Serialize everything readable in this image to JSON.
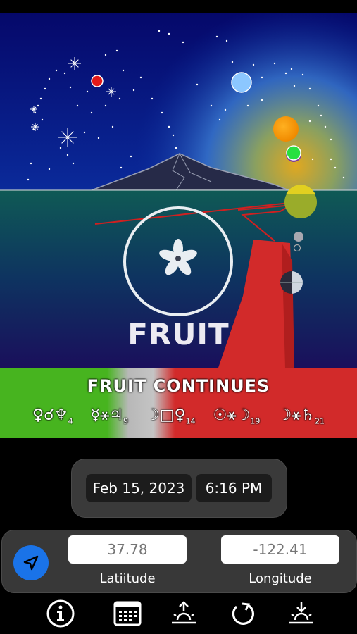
{
  "app": {
    "title": "FRUIT",
    "banner_title": "FRUIT CONTINUES",
    "aspects": [
      {
        "glyphs": "♀☌♆",
        "sub": "4"
      },
      {
        "glyphs": "☿⚹♃",
        "sub": "9"
      },
      {
        "glyphs": "☽□♀",
        "sub": "14"
      },
      {
        "glyphs": "☉⚹☽",
        "sub": "19"
      },
      {
        "glyphs": "☽⚹♄",
        "sub": "21"
      }
    ]
  },
  "datetime": {
    "date": "Feb 15, 2023",
    "time": "6:16 PM"
  },
  "location": {
    "latitude_placeholder": "37.78",
    "longitude_placeholder": "-122.41",
    "latitude_label": "Latiitude",
    "longitude_label": "Longitude"
  },
  "toolbar": {
    "items": [
      "info-icon",
      "calendar-icon",
      "sunrise-icon",
      "refresh-icon",
      "sunset-icon"
    ]
  },
  "colors": {
    "banner_green": "#47b41f",
    "banner_red": "#d22a2a",
    "locate_blue": "#1a73e8",
    "sky_top": "#04106e",
    "sea": "#0f5a55"
  }
}
